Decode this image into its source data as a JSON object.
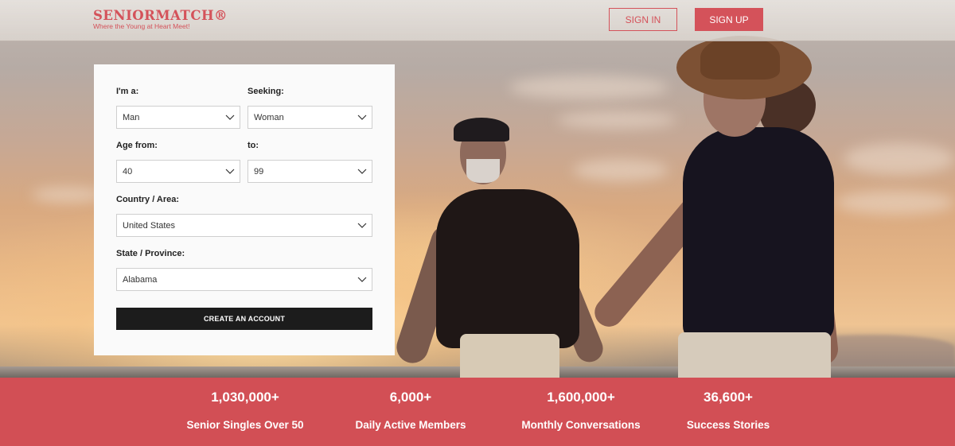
{
  "header": {
    "logo_name": "SENIORMATCH®",
    "logo_tagline": "Where the Young at Heart Meet!",
    "sign_in_label": "SIGN IN",
    "sign_up_label": "SIGN UP"
  },
  "form": {
    "gender": {
      "label": "I'm a:",
      "value": "Man"
    },
    "seeking": {
      "label": "Seeking:",
      "value": "Woman"
    },
    "age_from": {
      "label": "Age from:",
      "value": "40"
    },
    "age_to": {
      "label": "to:",
      "value": "99"
    },
    "country": {
      "label": "Country / Area:",
      "value": "United States"
    },
    "state": {
      "label": "State / Province:",
      "value": "Alabama"
    },
    "submit_label": "CREATE AN ACCOUNT"
  },
  "stats": [
    {
      "value": "1,030,000+",
      "label": "Senior Singles Over 50"
    },
    {
      "value": "6,000+",
      "label": "Daily Active Members"
    },
    {
      "value": "1,600,000+",
      "label": "Monthly Conversations"
    },
    {
      "value": "36,600+",
      "label": "Success Stories"
    }
  ],
  "colors": {
    "brand": "#d4525a",
    "stats_bar": "#d24f55",
    "button_dark": "#1c1c1c"
  },
  "icons": {
    "select_arrow": "chevron-down-icon"
  }
}
